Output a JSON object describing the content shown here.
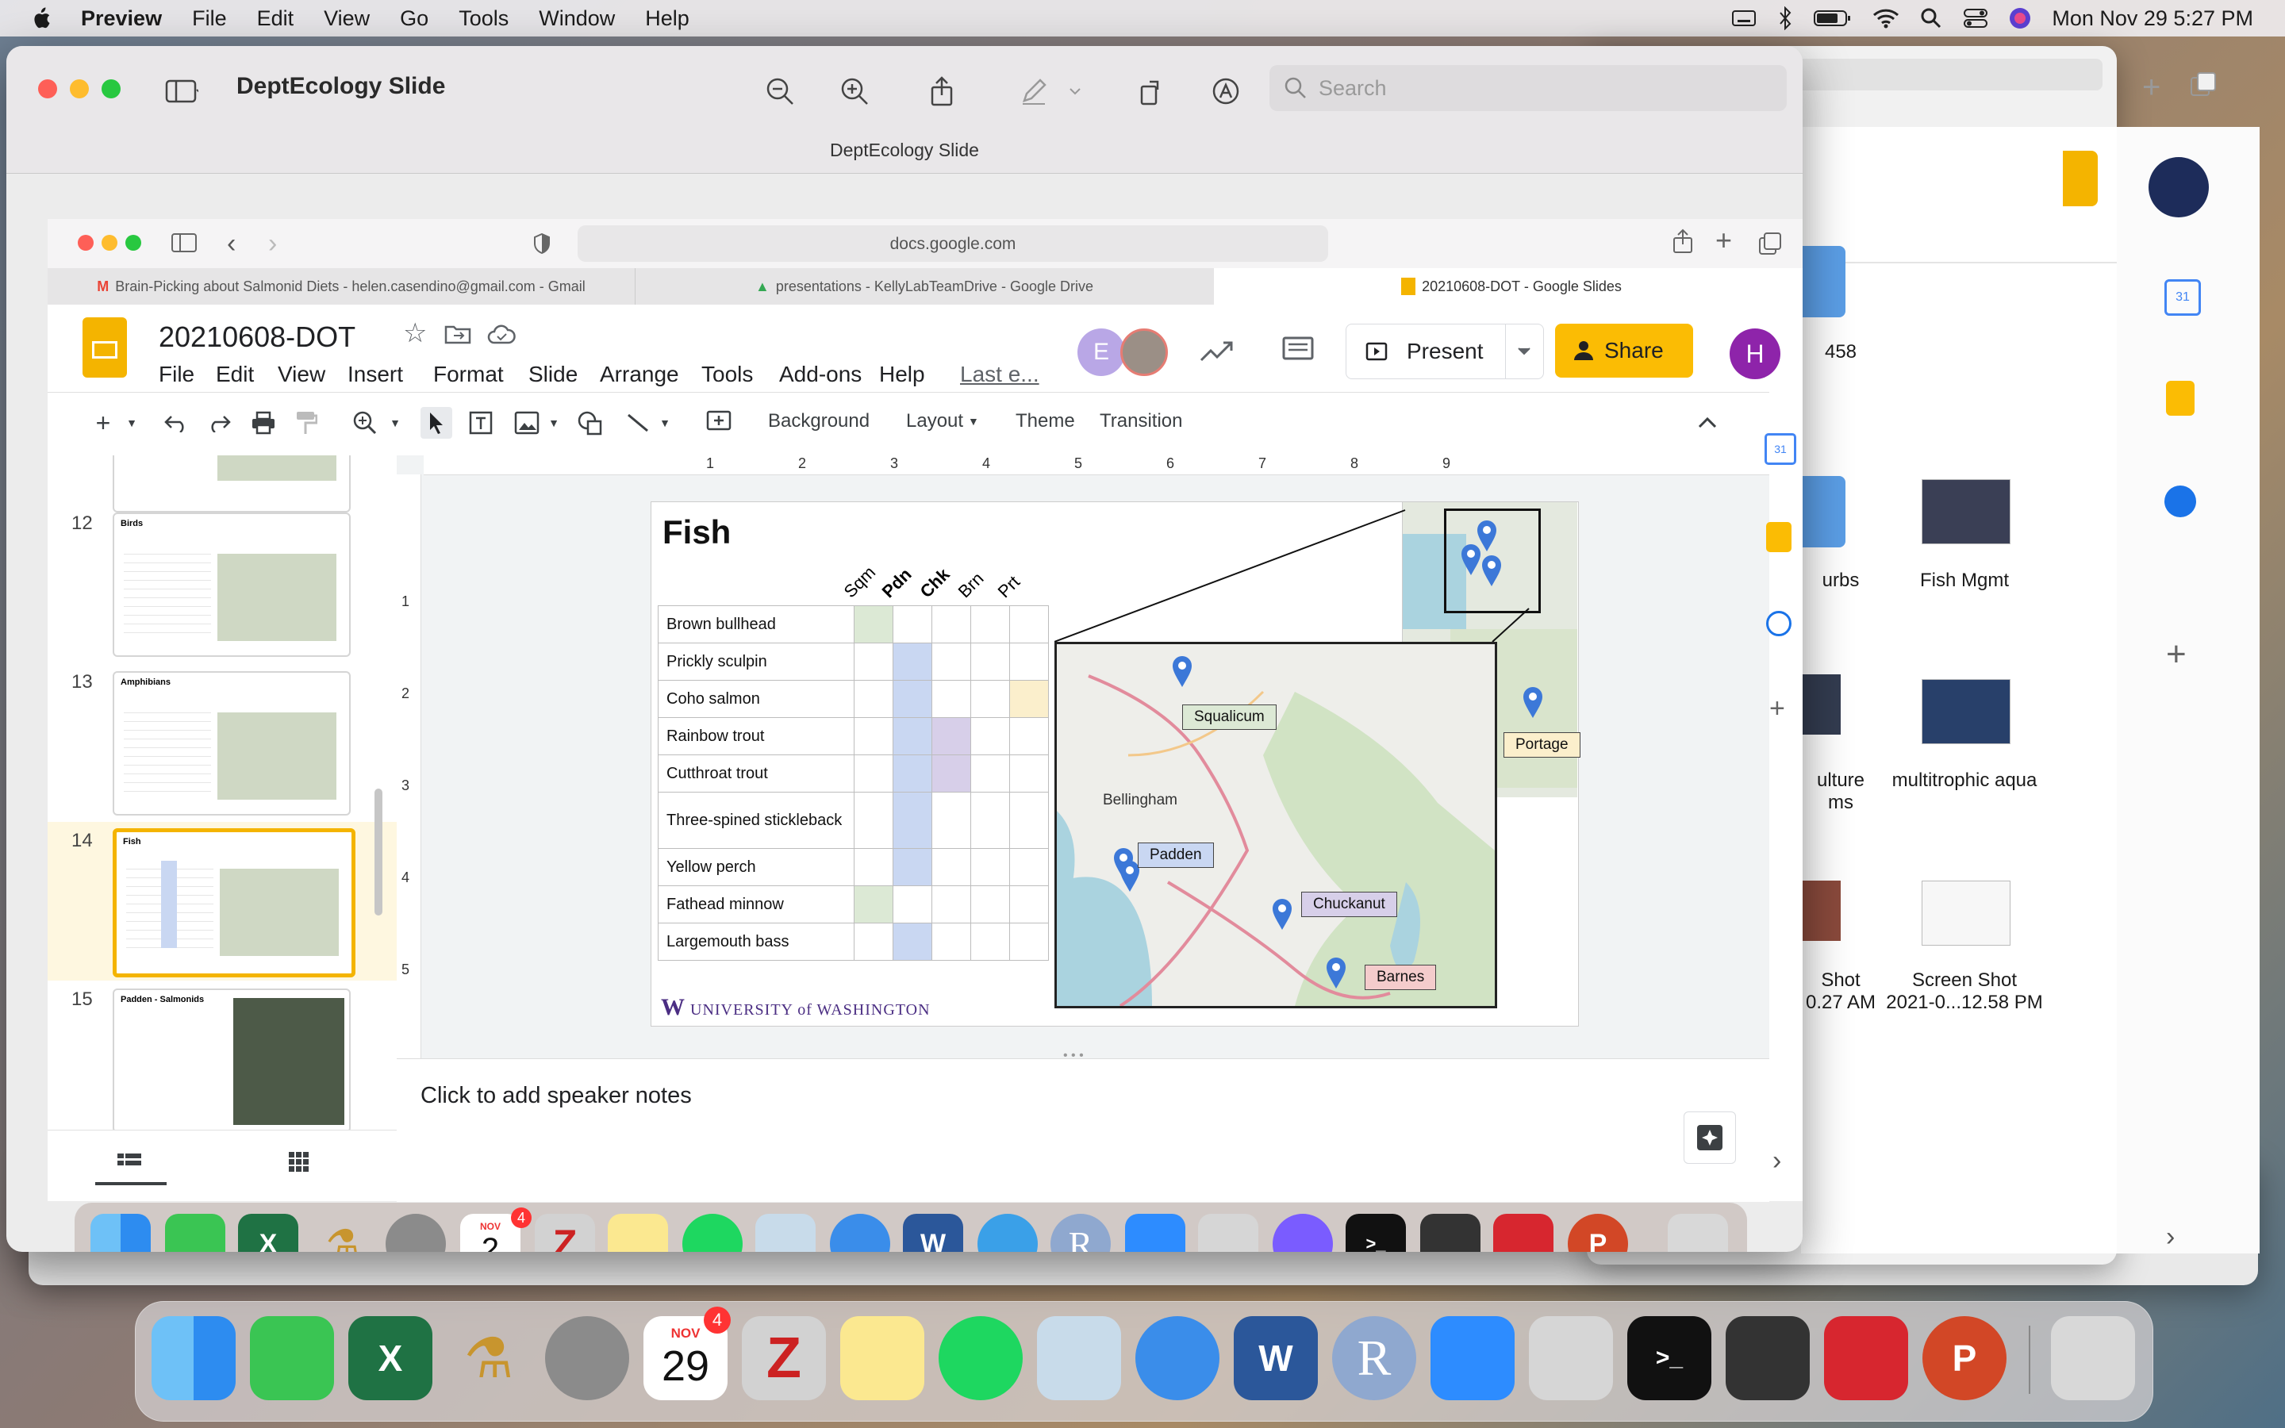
{
  "menubar": {
    "app_name": "Preview",
    "items": [
      "File",
      "Edit",
      "View",
      "Go",
      "Tools",
      "Window",
      "Help"
    ],
    "clock": "Mon Nov 29  5:27 PM"
  },
  "finder": {
    "items": [
      "458",
      "urbs",
      "Fish Mgmt",
      "ulture\nms",
      "multitrophic aqua",
      "Shot\n0.27 AM",
      "Screen Shot\n2021-0...12.58 PM"
    ]
  },
  "preview": {
    "title": "DeptEcology Slide",
    "subtitle": "DeptEcology Slide",
    "search_placeholder": "Search"
  },
  "safari": {
    "url": "docs.google.com",
    "tabs": [
      "Brain-Picking about Salmonid Diets - helen.casendino@gmail.com - Gmail",
      "presentations - KellyLabTeamDrive - Google Drive",
      "20210608-DOT - Google Slides"
    ]
  },
  "slides_app": {
    "doc_title": "20210608-DOT",
    "menus": [
      "File",
      "Edit",
      "View",
      "Insert",
      "Format",
      "Slide",
      "Arrange",
      "Tools",
      "Add-ons",
      "Help"
    ],
    "last_edit": "Last e...",
    "present_label": "Present",
    "share_label": "Share",
    "avatar_e": "E",
    "avatar_h": "H",
    "toolbar": {
      "background": "Background",
      "layout": "Layout",
      "theme": "Theme",
      "transition": "Transition"
    },
    "ruler_h": [
      "1",
      "2",
      "3",
      "4",
      "5",
      "6",
      "7",
      "8",
      "9"
    ],
    "ruler_v": [
      "1",
      "2",
      "3",
      "4",
      "5"
    ],
    "filmstrip": [
      {
        "num": "12",
        "title": "Birds"
      },
      {
        "num": "13",
        "title": "Amphibians"
      },
      {
        "num": "14",
        "title": "Fish"
      },
      {
        "num": "15",
        "title": "Padden - Salmonids"
      }
    ],
    "notes_placeholder": "Click to add speaker notes"
  },
  "slide": {
    "title": "Fish",
    "columns": [
      "Sqm",
      "Pdn",
      "Chk",
      "Brn",
      "Prt"
    ],
    "rows": [
      "Brown bullhead",
      "Prickly sculpin",
      "Coho salmon",
      "Rainbow trout",
      "Cutthroat trout",
      "Three-spined stickleback",
      "Yellow perch",
      "Fathead minnow",
      "Largemouth bass"
    ],
    "cell_colors": {
      "green": "#dce9d5",
      "blue": "#c9d7f2",
      "purple": "#d7cfe9",
      "yellow": "#fbefcc"
    },
    "logo_text": "UNIVERSITY of WASHINGTON",
    "map_labels": {
      "squalicum": "Squalicum",
      "portage": "Portage",
      "padden": "Padden",
      "chuckanut": "Chuckanut",
      "barnes": "Barnes",
      "bellingham": "Bellingham"
    }
  },
  "dock_inner": {
    "calendar_month": "NOV",
    "calendar_day": "2",
    "badge": "4"
  },
  "dock": {
    "calendar_month": "NOV",
    "calendar_day": "29",
    "badge": "4"
  }
}
